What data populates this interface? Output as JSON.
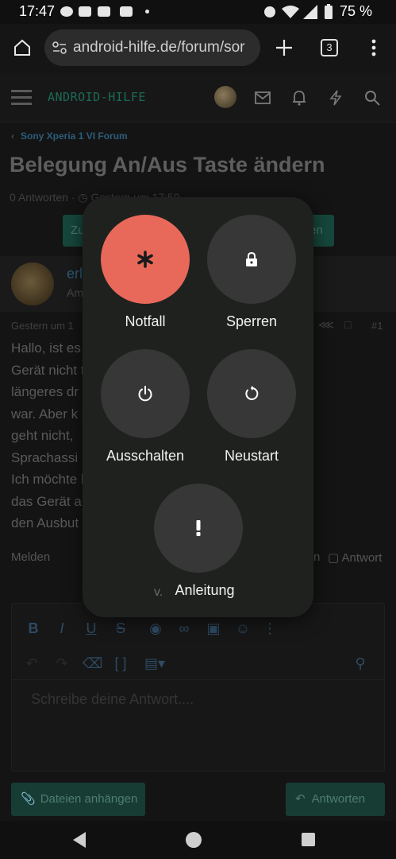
{
  "status_bar": {
    "time": "17:47",
    "battery": "75 %"
  },
  "browser": {
    "url": "android-hilfe.de/forum/sor",
    "tab_count": "3"
  },
  "site": {
    "logo_text": "ANDROID-HILFE"
  },
  "forum": {
    "breadcrumb": "Sony Xperia 1 VI Forum",
    "thread_title": "Belegung An/Aus Taste ändern",
    "thread_meta": "0 Antworten · ◷ Gestern um 17:50",
    "btn_left": "Zu",
    "btn_right": "en",
    "author": "erl",
    "author_role": "Am",
    "post_date": "Gestern um 1",
    "post_number": "#1",
    "post_lines": [
      "Hallo, ist es                                             te das",
      "Gerät nicht                                              ten durch",
      "längeres dr                                              eschaltet",
      "war. Aber k                                               s drücken",
      "geht nicht,",
      "Sprachassi                                               umstellen?",
      "Ich möchte                                               halte ich",
      "das Gerät a                                              nd dann",
      "den Ausbut"
    ],
    "report_label": "Melden",
    "reply_action": "Antwort",
    "editor_placeholder": "Schreibe deine Antwort....",
    "attach_label": "Dateien anhängen",
    "submit_label": "Antworten"
  },
  "power_menu": {
    "emergency_label": "Notfall",
    "lock_label": "Sperren",
    "power_off_label": "Ausschalten",
    "restart_label": "Neustart",
    "guide_label": "Anleitung",
    "guide_ghost": "v.",
    "emergency_color": "#e8695a"
  }
}
